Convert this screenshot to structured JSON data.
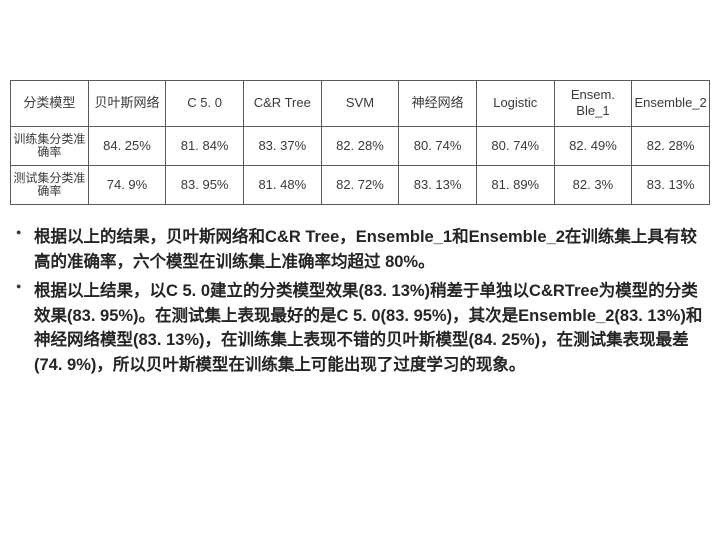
{
  "chart_data": {
    "type": "table",
    "headers": [
      "分类模型",
      "贝叶斯网络",
      "C 5. 0",
      "C&R Tree",
      "SVM",
      "神经网络",
      "Logistic",
      "Ensem. Ble_1",
      "Ensemble_2"
    ],
    "rows": [
      {
        "label": "训练集分类准确率",
        "values": [
          "84. 25%",
          "81. 84%",
          "83. 37%",
          "82. 28%",
          "80. 74%",
          "80. 74%",
          "82. 49%",
          "82. 28%"
        ]
      },
      {
        "label": "测试集分类准确率",
        "values": [
          "74. 9%",
          "83. 95%",
          "81. 48%",
          "82. 72%",
          "83. 13%",
          "81. 89%",
          "82. 3%",
          "83. 13%"
        ]
      }
    ]
  },
  "bullets": [
    "根据以上的结果，贝叶斯网络和C&R Tree，Ensemble_1和Ensemble_2在训练集上具有较高的准确率，六个模型在训练集上准确率均超过 80%。",
    "根据以上结果，以C 5. 0建立的分类模型效果(83. 13%)稍差于单独以C&RTree为模型的分类效果(83. 95%)。在测试集上表现最好的是C 5. 0(83. 95%)，其次是Ensemble_2(83. 13%)和神经网络模型(83. 13%)，在训练集上表现不错的贝叶斯模型(84. 25%)，在测试集表现最差(74. 9%)，所以贝叶斯模型在训练集上可能出现了过度学习的现象。"
  ]
}
